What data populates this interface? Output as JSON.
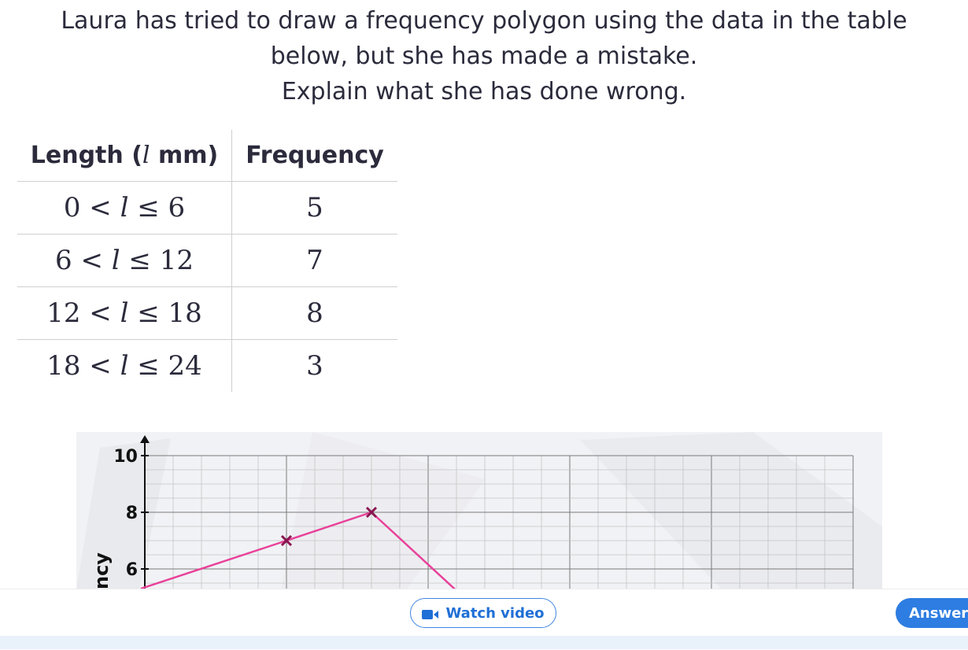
{
  "question": {
    "line1": "Laura has tried to draw a frequency polygon using the data in the table",
    "line2": "below, but she has made a mistake.",
    "line3": "Explain what she has done wrong."
  },
  "table": {
    "header_length_prefix": "Length (",
    "header_length_var": "l",
    "header_length_suffix": " mm)",
    "header_frequency": "Frequency",
    "rows": [
      {
        "lo": "0",
        "hi": "6",
        "freq": "5"
      },
      {
        "lo": "6",
        "hi": "12",
        "freq": "7"
      },
      {
        "lo": "12",
        "hi": "18",
        "freq": "8"
      },
      {
        "lo": "18",
        "hi": "24",
        "freq": "3"
      }
    ],
    "lt": "<",
    "var": "l",
    "le": "≤"
  },
  "chart_data": {
    "type": "line",
    "ylabel": "ncy",
    "y_ticks": [
      "10",
      "8",
      "6"
    ],
    "y_range_visible": [
      5,
      10.5
    ],
    "points_marked": [
      {
        "x": 10,
        "y": 7
      },
      {
        "x": 16,
        "y": 8
      }
    ],
    "line_continues_below_view": true,
    "line_color": "#e8419a",
    "marker_color": "#8b1550",
    "grid": true
  },
  "footer": {
    "watch_video": "Watch video",
    "answer": "Answer"
  }
}
